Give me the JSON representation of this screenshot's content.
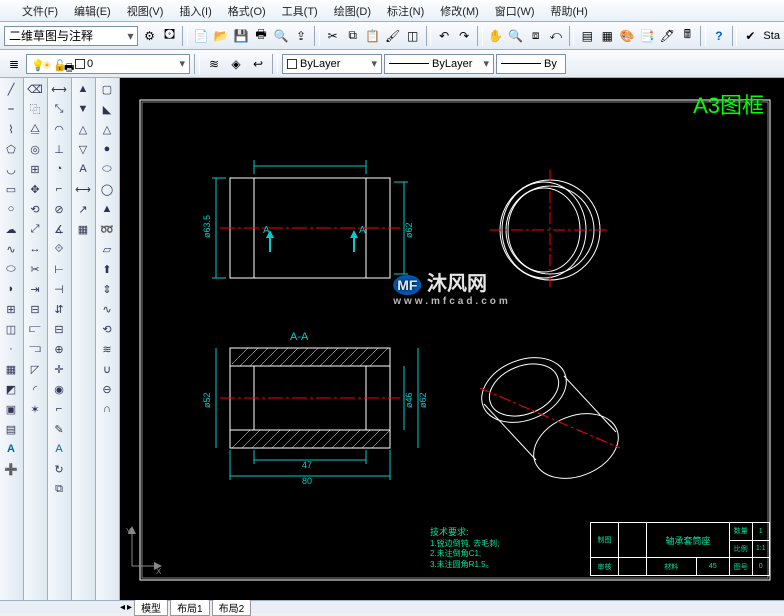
{
  "menu": {
    "file": "文件(F)",
    "edit": "编辑(E)",
    "view": "视图(V)",
    "insert": "插入(I)",
    "format": "格式(O)",
    "tools": "工具(T)",
    "draw": "绘图(D)",
    "dimension": "标注(N)",
    "modify": "修改(M)",
    "window": "窗口(W)",
    "help": "帮助(H)"
  },
  "workspace": {
    "value": "二维草图与注释"
  },
  "layer": {
    "current": "0"
  },
  "props": {
    "color": "ByLayer",
    "linetype": "ByLayer",
    "lineweight": "By"
  },
  "standards_label": "Sta",
  "frame": {
    "title": "A3图框"
  },
  "drawing": {
    "section_label": "A-A",
    "callout_a_left": "A",
    "callout_a_right": "A",
    "dim_outer": "ø63.5",
    "dim_bore": "ø62",
    "dim_sect_outer": "ø52",
    "dim_sect_inner": "ø46",
    "dim_sect_bore": "ø62",
    "dim_len_inner": "47",
    "dim_len_outer": "80"
  },
  "techreq": {
    "title": "技术要求:",
    "l1": "1.锐边倒钝, 去毛刺;",
    "l2": "2.未注倒角C1;",
    "l3": "3.未注圆角R1.5。"
  },
  "titleblock": {
    "part_name": "轴承套筒座",
    "scale_lbl": "比例",
    "scale_val": "1:1",
    "mat_lbl": "材料",
    "mat_val": "45",
    "qty_lbl": "数量",
    "qty_val": "1",
    "sheet_lbl": "图号",
    "sheet_val": "0",
    "drawn_lbl": "制图",
    "check_lbl": "审核"
  },
  "watermark": {
    "name": "沐风网",
    "url": "www.mfcad.com"
  },
  "tabs": {
    "model": "模型",
    "layout1": "布局1",
    "layout2": "布局2"
  }
}
